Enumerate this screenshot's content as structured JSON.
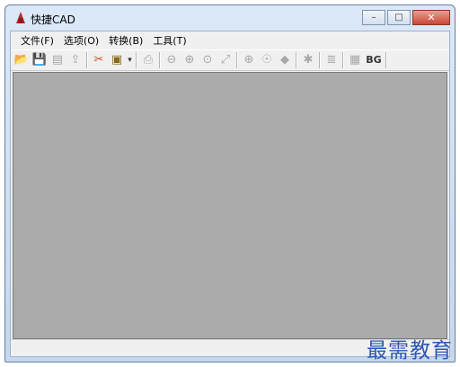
{
  "window": {
    "title": "快捷CAD",
    "minimize_glyph": "–",
    "maximize_glyph": "□",
    "close_glyph": "✕"
  },
  "menu": {
    "items": [
      {
        "label": "文件(F)"
      },
      {
        "label": "选项(O)"
      },
      {
        "label": "转换(B)"
      },
      {
        "label": "工具(T)"
      }
    ]
  },
  "toolbar": {
    "open_glyph": "📂",
    "save_glyph": "💾",
    "save_all_glyph": "▤",
    "export_glyph": "⇪",
    "convert_glyph": "✂",
    "batch_glyph": "▣",
    "dropdown_glyph": "▾",
    "print_glyph": "⎙",
    "zoom_out_glyph": "⊖",
    "zoom_in_glyph": "⊕",
    "zoom_window_glyph": "⊙",
    "zoom_prev_glyph": "⤢",
    "zoom_all_glyph": "⊕",
    "pan_glyph": "☉",
    "view_glyph": "◆",
    "layer_glyph": "✱",
    "layers_glyph": "≣",
    "grid_glyph": "▦",
    "bg_label": "BG"
  },
  "watermark": "最需教育",
  "colors": {
    "canvas": "#ababab",
    "title_bar": "#c5d8ee",
    "close_button": "#c84634",
    "watermark": "#2b57b7"
  }
}
